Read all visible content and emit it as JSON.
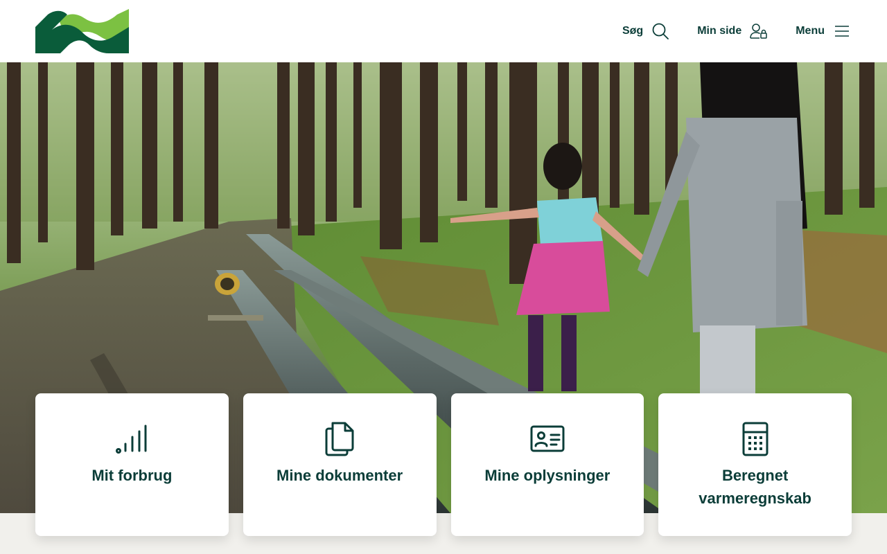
{
  "header": {
    "nav": {
      "search_label": "Søg",
      "my_page_label": "Min side",
      "menu_label": "Menu"
    }
  },
  "cards": [
    {
      "label": "Mit forbrug",
      "icon": "signal-bars-icon"
    },
    {
      "label": "Mine dokumenter",
      "icon": "documents-icon"
    },
    {
      "label": "Mine oplysninger",
      "icon": "id-card-icon"
    },
    {
      "label": "Beregnet varmeregnskab",
      "icon": "calculator-icon"
    }
  ],
  "colors": {
    "brand_dark": "#0b3d38",
    "logo_dark_green": "#0a5c3a",
    "logo_light_green": "#7cc142",
    "band": "#f1f0ec"
  }
}
